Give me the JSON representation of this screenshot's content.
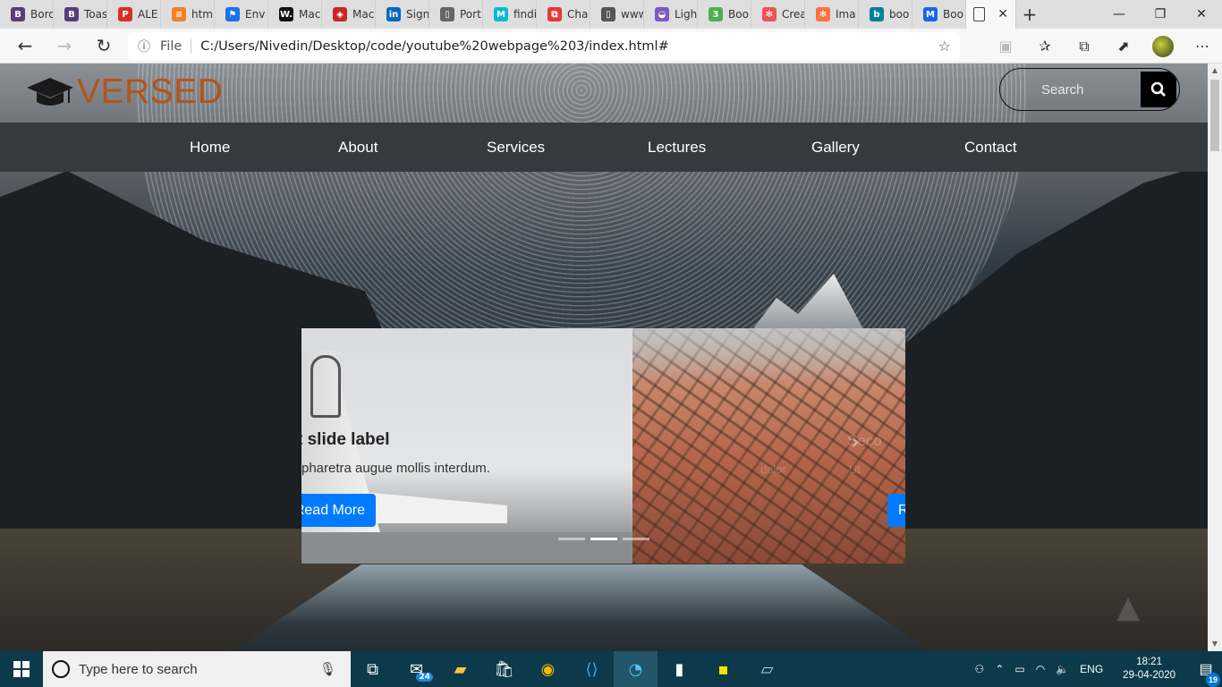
{
  "browser": {
    "tabs": [
      {
        "label": "Bord",
        "icon": "bootstrap-icon",
        "color": "#563d7c",
        "glyph": "B"
      },
      {
        "label": "Toas",
        "icon": "bootstrap-icon",
        "color": "#563d7c",
        "glyph": "B"
      },
      {
        "label": "ALE",
        "icon": "pdf-icon",
        "color": "#d93025",
        "glyph": "P"
      },
      {
        "label": "htm",
        "icon": "stackoverflow-icon",
        "color": "#f48024",
        "glyph": "≡"
      },
      {
        "label": "Env",
        "icon": "flag-icon",
        "color": "#1a73e8",
        "glyph": "⚑"
      },
      {
        "label": "Mac",
        "icon": "w-icon",
        "color": "#111111",
        "glyph": "W."
      },
      {
        "label": "Mac",
        "icon": "shield-icon",
        "color": "#c62828",
        "glyph": "◈"
      },
      {
        "label": "Sign",
        "icon": "linkedin-icon",
        "color": "#0a66c2",
        "glyph": "in"
      },
      {
        "label": "Port",
        "icon": "page-icon",
        "color": "#666666",
        "glyph": "▯"
      },
      {
        "label": "findi",
        "icon": "m-icon",
        "color": "#00bcd4",
        "glyph": "M"
      },
      {
        "label": "Cha",
        "icon": "chat-icon",
        "color": "#e53935",
        "glyph": "⧉"
      },
      {
        "label": "www",
        "icon": "doc-icon",
        "color": "#555555",
        "glyph": "▯"
      },
      {
        "label": "Ligh",
        "icon": "ufo-icon",
        "color": "#7e57c2",
        "glyph": "◒"
      },
      {
        "label": "Boo",
        "icon": "code-icon",
        "color": "#4caf50",
        "glyph": "3"
      },
      {
        "label": "Crea",
        "icon": "flower-icon",
        "color": "#ef5350",
        "glyph": "✻"
      },
      {
        "label": "Ima",
        "icon": "flower-icon",
        "color": "#ff7043",
        "glyph": "✻"
      },
      {
        "label": "boo",
        "icon": "bing-icon",
        "color": "#00809d",
        "glyph": "b"
      },
      {
        "label": "Boo",
        "icon": "mdb-icon",
        "color": "#1266f1",
        "glyph": "M"
      }
    ],
    "url": "C:/Users/Nivedin/Desktop/code/youtube%20webpage%203/index.html#",
    "file_label": "File"
  },
  "site": {
    "brand": "VERSED",
    "brand_color": "#b3551a",
    "search_placeholder": "Search",
    "nav": [
      "Home",
      "About",
      "Services",
      "Lectures",
      "Gallery",
      "Contact"
    ]
  },
  "carousel": {
    "slide1_title": "t slide label",
    "slide1_text": "pharetra augue mollis interdum.",
    "read_more": "Read More",
    "slide2_title": "Seco",
    "slide2_text_a": "dolor",
    "slide2_text_b": "Ut",
    "read_more2": "R",
    "active_indicator": 1
  },
  "taskbar": {
    "search_placeholder": "Type here to search",
    "mail_badge": "24",
    "language": "ENG",
    "time": "18:21",
    "date": "29-04-2020",
    "notifications": "19"
  }
}
